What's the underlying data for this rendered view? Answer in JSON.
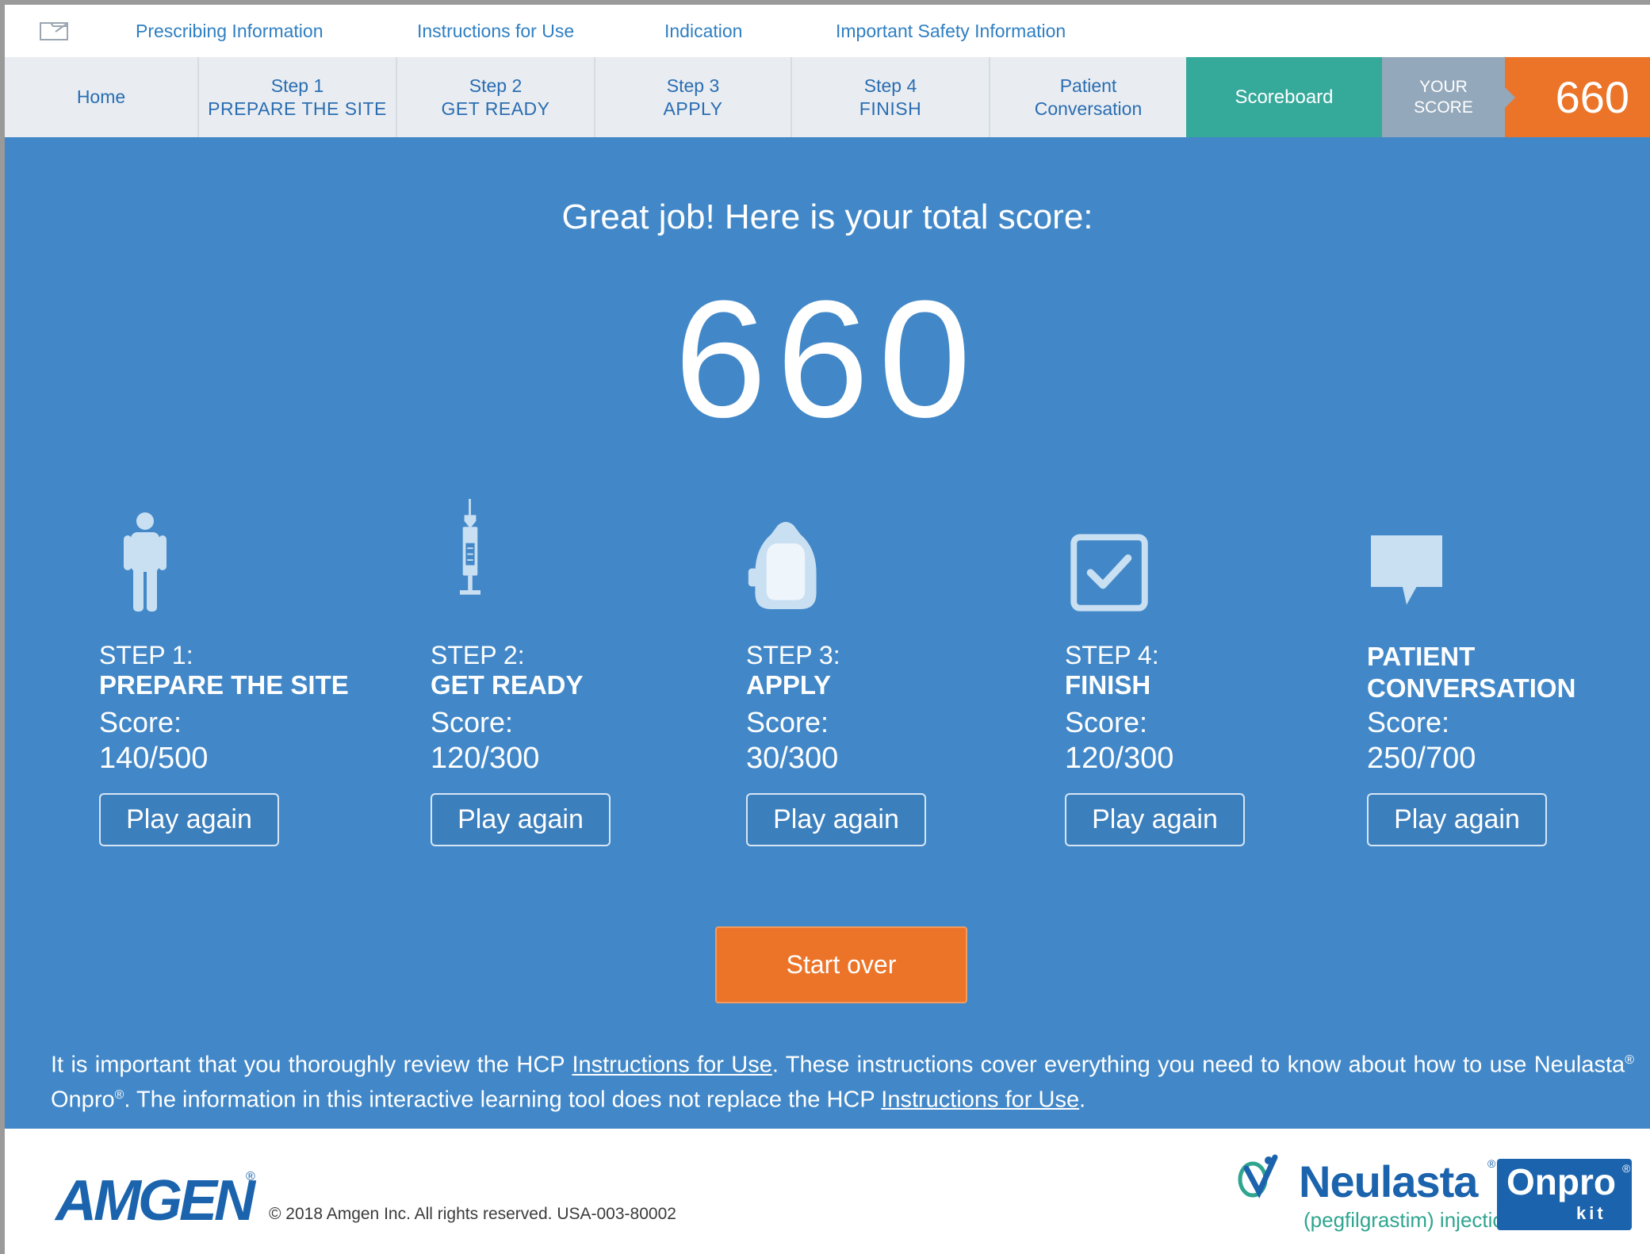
{
  "top_links": [
    "Prescribing Information",
    "Instructions for Use",
    "Indication",
    "Important Safety Information"
  ],
  "nav": {
    "home": "Home",
    "step1": {
      "line1": "Step 1",
      "line2": "PREPARE THE SITE"
    },
    "step2": {
      "line1": "Step 2",
      "line2": "GET READY"
    },
    "step3": {
      "line1": "Step 3",
      "line2": "APPLY"
    },
    "step4": {
      "line1": "Step 4",
      "line2": "FINISH"
    },
    "patient": {
      "line1": "Patient",
      "line2": "Conversation"
    },
    "scoreboard": "Scoreboard",
    "your_score": {
      "line1": "YOUR",
      "line2": "SCORE"
    },
    "score_value": "660"
  },
  "main": {
    "headline": "Great job! Here is your total score:",
    "total_score": "660",
    "steps": [
      {
        "pre": "STEP 1:",
        "title": "PREPARE THE SITE",
        "score_label": "Score:",
        "score": "140/500",
        "button": "Play again",
        "icon": "person-icon"
      },
      {
        "pre": "STEP 2:",
        "title": "GET READY",
        "score_label": "Score:",
        "score": "120/300",
        "button": "Play again",
        "icon": "syringe-icon"
      },
      {
        "pre": "STEP 3:",
        "title": "APPLY",
        "score_label": "Score:",
        "score": "30/300",
        "button": "Play again",
        "icon": "injector-icon"
      },
      {
        "pre": "STEP 4:",
        "title": "FINISH",
        "score_label": "Score:",
        "score": "120/300",
        "button": "Play again",
        "icon": "checkbox-icon"
      },
      {
        "title_line1": "PATIENT",
        "title_line2": "CONVERSATION",
        "score_label": "Score:",
        "score": "250/700",
        "button": "Play again",
        "icon": "speech-bubble-icon"
      }
    ],
    "start_over": "Start over",
    "disclaimer": {
      "part1": "It is important that you thoroughly review the HCP ",
      "link1": "Instructions for Use",
      "part2": ". These instructions cover everything you need to know about how to use Neulasta",
      "reg1": "®",
      "part3": " Onpro",
      "reg2": "®",
      "part4": ". The information in this interactive learning tool does not replace the HCP ",
      "link2": "Instructions for Use",
      "part5": "."
    }
  },
  "footer": {
    "amgen_logo": "AMGEN",
    "amgen_reg": "®",
    "copyright": "© 2018 Amgen Inc. All rights reserved.  USA-003-80002",
    "neulasta": "Neulasta",
    "neulasta_reg": "®",
    "neulasta_sub": "(pegfilgrastim) injection",
    "onpro": "Onpro",
    "onpro_reg": "®",
    "kit": "kit"
  },
  "colors": {
    "main_blue": "#4288c8",
    "orange": "#ec7429",
    "teal": "#35a99a",
    "nav_bg": "#e9edf1",
    "brand_blue": "#1b63ad"
  }
}
